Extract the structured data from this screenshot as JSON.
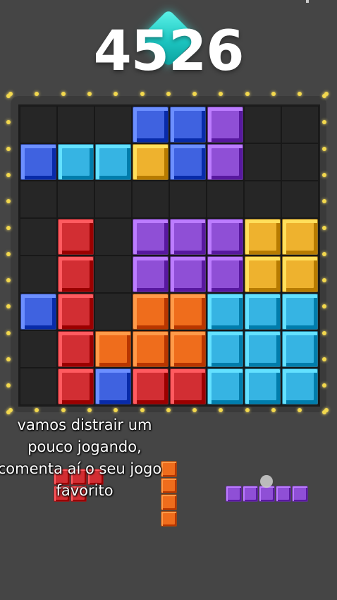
{
  "score": "4526",
  "caption": [
    "vamos distrair um",
    "pouco jogando,",
    "comenta aí o seu jogo",
    "favorito"
  ],
  "colors": {
    "blue": "#3f62e0",
    "cyan": "#36b4e3",
    "purple": "#8f4fd6",
    "yellow": "#eeb22e",
    "red": "#d22e33",
    "orange": "#ef6d1c"
  },
  "board": [
    [
      "",
      "",
      "",
      "blue",
      "blue",
      "purple",
      "",
      ""
    ],
    [
      "blue",
      "cyan",
      "cyan",
      "yellow",
      "blue",
      "purple",
      "",
      ""
    ],
    [
      "",
      "",
      "",
      "",
      "",
      "",
      "",
      ""
    ],
    [
      "",
      "red",
      "",
      "purple",
      "purple",
      "purple",
      "yellow",
      "yellow"
    ],
    [
      "",
      "red",
      "",
      "purple",
      "purple",
      "purple",
      "yellow",
      "yellow"
    ],
    [
      "blue",
      "red",
      "",
      "orange",
      "orange",
      "cyan",
      "cyan",
      "cyan"
    ],
    [
      "",
      "red",
      "orange",
      "orange",
      "orange",
      "cyan",
      "cyan",
      "cyan"
    ],
    [
      "",
      "red",
      "blue",
      "red",
      "red",
      "cyan",
      "cyan",
      "cyan"
    ]
  ],
  "tray": [
    {
      "name": "tray-piece-red-t",
      "color": "red",
      "cells": [
        [
          0,
          0
        ],
        [
          1,
          0
        ],
        [
          2,
          0
        ],
        [
          1,
          1
        ],
        [
          0,
          1
        ]
      ]
    },
    {
      "name": "tray-piece-orange-i",
      "color": "orange",
      "cells": [
        [
          0,
          0
        ],
        [
          0,
          1
        ],
        [
          0,
          2
        ],
        [
          0,
          3
        ]
      ]
    },
    {
      "name": "tray-piece-purple-i",
      "color": "purple",
      "cells": [
        [
          0,
          0
        ],
        [
          1,
          0
        ],
        [
          2,
          0
        ],
        [
          3,
          0
        ],
        [
          4,
          0
        ]
      ]
    }
  ]
}
